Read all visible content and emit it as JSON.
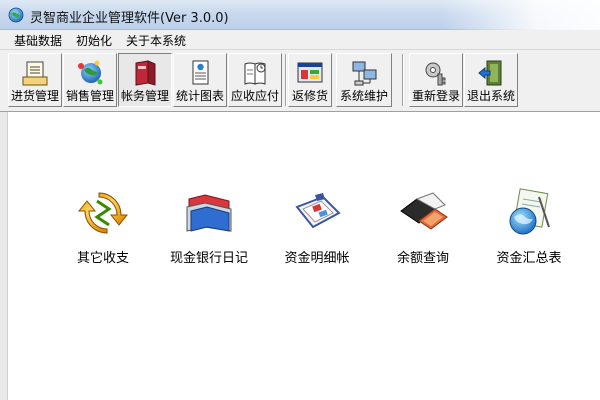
{
  "window": {
    "title": "灵智商业企业管理软件(Ver 3.0.0)"
  },
  "menu": {
    "items": [
      {
        "label": "基础数据"
      },
      {
        "label": "初始化"
      },
      {
        "label": "关于本系统"
      }
    ]
  },
  "toolbar": {
    "buttons": [
      {
        "label": "进货管理",
        "icon": "purchase-icon"
      },
      {
        "label": "销售管理",
        "icon": "globe-icon"
      },
      {
        "label": "帐务管理",
        "icon": "ledger-book-icon",
        "pressed": true
      },
      {
        "label": "统计图表",
        "icon": "report-icon"
      },
      {
        "label": "应收应付",
        "icon": "receivable-book-icon"
      },
      {
        "label": "返修货",
        "icon": "monitor-window-icon"
      },
      {
        "label": "系统维护",
        "icon": "network-computer-icon"
      },
      {
        "label": "重新登录",
        "icon": "key-icon"
      },
      {
        "label": "退出系统",
        "icon": "exit-door-icon"
      }
    ]
  },
  "functions": [
    {
      "label": "其它收支",
      "icon": "refresh-arrows-icon"
    },
    {
      "label": "现金银行日记",
      "icon": "folders-icon"
    },
    {
      "label": "资金明细帐",
      "icon": "clipboard-icon"
    },
    {
      "label": "余额查询",
      "icon": "wallet-icon"
    },
    {
      "label": "资金汇总表",
      "icon": "globe-document-icon"
    }
  ],
  "colors": {
    "titlebar": "#c9d9ee",
    "chrome": "#f0f0f0",
    "content": "#ffffff"
  }
}
